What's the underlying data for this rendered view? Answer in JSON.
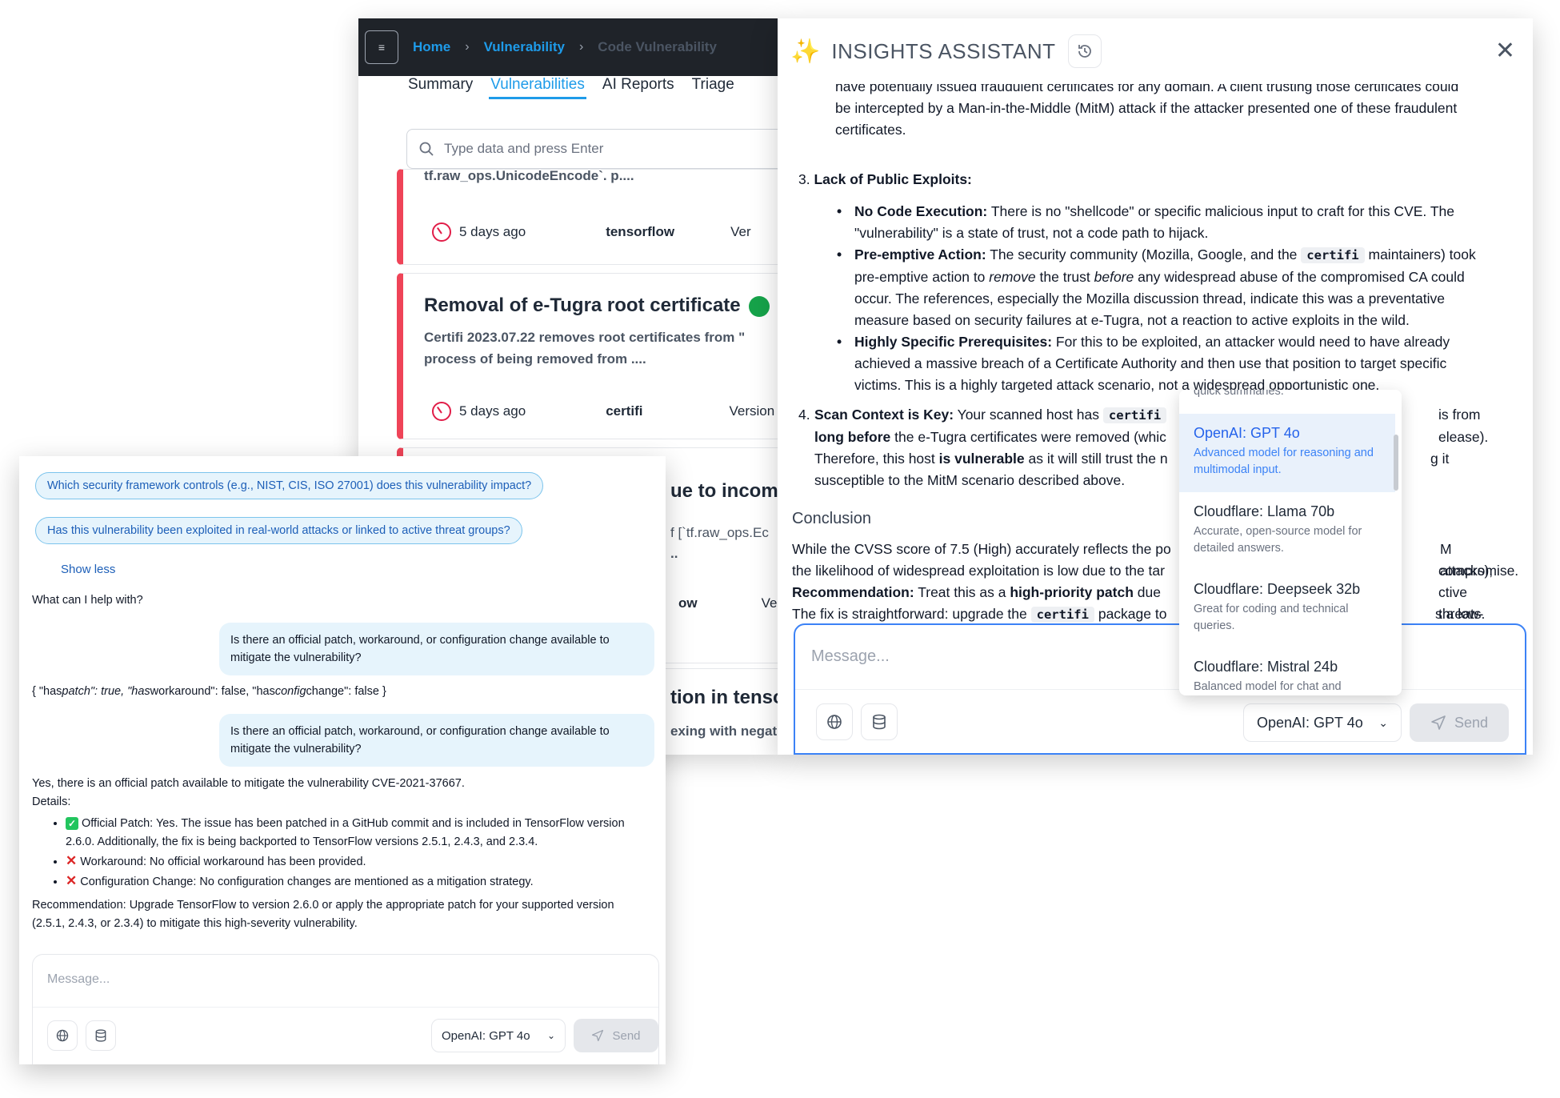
{
  "background_app": {
    "breadcrumb": {
      "home": "Home",
      "vulnerability": "Vulnerability",
      "current": "Code Vulnerability"
    },
    "tabs": [
      "Summary",
      "Vulnerabilities",
      "AI Reports",
      "Triage"
    ],
    "active_tab": "Vulnerabilities",
    "search_placeholder": "Type data and press Enter",
    "cards": [
      {
        "top_fragment": "tf.raw_ops.UnicodeEncode`.    p....",
        "time": "5 days ago",
        "package": "tensorflow",
        "version_fragment": "Ver"
      },
      {
        "title": "Removal of e-Tugra root certificate",
        "desc1": "Certifi 2023.07.22 removes root certificates from \"",
        "desc2": "process of being removed from ....",
        "time": "5 days ago",
        "package": "certifi",
        "version_fragment": "Version"
      },
      {
        "title_fragment": "ue to incom",
        "desc_fragment1": "f [`tf.raw_ops.Ec",
        "desc_fragment2": "..",
        "package_fragment": "ow",
        "version_fragment": "Ve"
      },
      {
        "title_fragment": "tion in tenso",
        "desc_fragment": "exing with negat"
      }
    ]
  },
  "assistant": {
    "title": "INSIGHTS ASSISTANT",
    "frag_line1": "have potentially issued fraudulent certificates for any domain. A client trusting those certificates could",
    "frag_line2": "be intercepted by a Man-in-the-Middle (MitM) attack if the attacker presented one of these fraudulent",
    "frag_line3": "certificates.",
    "lack_heading_num": "3.",
    "lack_heading": "Lack of Public Exploits:",
    "bullet1_bold": "No Code Execution:",
    "bullet1_text": "There is no \"shellcode\" or specific malicious input to craft for this CVE. The \"vulnerability\" is a state of trust, not a code path to hijack.",
    "bullet2_bold": "Pre-emptive Action:",
    "bullet2_a": "The security community (Mozilla, Google, and the",
    "bullet2_code": "certifi",
    "bullet2_b": "maintainers) took pre-emptive action to",
    "bullet2_em1": "remove",
    "bullet2_c": "the trust",
    "bullet2_em2": "before",
    "bullet2_d": "any widespread abuse of the compromised CA could occur. The references, especially the Mozilla discussion thread, indicate this was a preventative measure based on security failures at e-Tugra, not a reaction to active exploits in the wild.",
    "bullet3_bold": "Highly Specific Prerequisites:",
    "bullet3_text": "For this to be exploited, an attacker would need to have already achieved a massive breach of a Certificate Authority and then use that position to target specific victims. This is a highly targeted attack scenario, not a widespread opportunistic one.",
    "scan_num": "4.",
    "scan_bold": "Scan Context is Key:",
    "scan_a": "Your scanned host has",
    "scan_code": "certifi",
    "scan_end1": "is from",
    "scan_bold2": "long before",
    "scan_b": "the e-Tugra certificates were removed (whic",
    "scan_end2": "elease).",
    "scan_c": "Therefore, this host",
    "scan_bold3": "is vulnerable",
    "scan_d": "as it will still trust the n",
    "scan_end3": "g it",
    "scan_e": "susceptible to the MitM scenario described above.",
    "conclusion_heading": "Conclusion",
    "conc1_a": "While the CVSS score of 7.5 (High) accurately reflects the po",
    "conc1_b": "M attacks),",
    "conc2_a": "the likelihood of widespread exploitation is low due to the tar",
    "conc2_b": "compromise.",
    "conc3_bold": "Recommendation:",
    "conc3_a": "Treat this as a",
    "conc3_bold2": "high-priority patch",
    "conc3_b": "due",
    "conc3_c": "ctive threats.",
    "conc4_a": "The fix is straightforward: upgrade the",
    "conc4_code": "certifi",
    "conc4_b": "package to",
    "conc4_c": "s a low-risk",
    "input_placeholder": "Message...",
    "model_label": "OpenAI: GPT 4o",
    "send_label": "Send"
  },
  "model_dropdown": {
    "top_fragment": "quick summaries.",
    "options": [
      {
        "name": "OpenAI: GPT 4o",
        "desc": "Advanced model for reasoning and multimodal input.",
        "selected": true
      },
      {
        "name": "Cloudflare: Llama 70b",
        "desc": "Accurate, open-source model for detailed answers.",
        "selected": false
      },
      {
        "name": "Cloudflare: Deepseek 32b",
        "desc": "Great for coding and technical queries.",
        "selected": false
      },
      {
        "name": "Cloudflare: Mistral 24b",
        "desc": "Balanced model for chat and",
        "selected": false
      }
    ]
  },
  "chat": {
    "suggestions": [
      "Which security framework controls (e.g., NIST, CIS, ISO 27001) does this vulnerability impact?",
      "Has this vulnerability been exploited in real-world attacks or linked to active threat groups?"
    ],
    "show_less": "Show less",
    "greeting": "What can I help with?",
    "user_msg_1": "Is there an official patch, workaround, or configuration change available to mitigate the vulnerability?",
    "json_a": "{ \"has",
    "json_b": "patch\": true, \"has",
    "json_c": "workaround\": false, \"has",
    "json_d": "config",
    "json_e": "change\": false }",
    "user_msg_2": "Is there an official patch, workaround, or configuration change available to mitigate the vulnerability?",
    "answer_intro": "Yes, there is an official patch available to mitigate the vulnerability CVE-2021-37667.",
    "answer_details": "Details:",
    "answer_item_1": "Official Patch: Yes. The issue has been patched in a GitHub commit and is included in TensorFlow version 2.6.0. Additionally, the fix is being backported to TensorFlow versions 2.5.1, 2.4.3, and 2.3.4.",
    "answer_item_2": "Workaround: No official workaround has been provided.",
    "answer_item_3": "Configuration Change: No configuration changes are mentioned as a mitigation strategy.",
    "answer_recommendation": "Recommendation: Upgrade TensorFlow to version 2.6.0 or apply the appropriate patch for your supported version (2.5.1, 2.4.3, or 2.3.4) to mitigate this high-severity vulnerability.",
    "input_placeholder": "Message...",
    "model_label": "OpenAI: GPT 4o",
    "send_label": "Send"
  },
  "colors": {
    "accent": "#1e9be9",
    "danger": "#ef4458",
    "focus": "#3b82f6"
  }
}
